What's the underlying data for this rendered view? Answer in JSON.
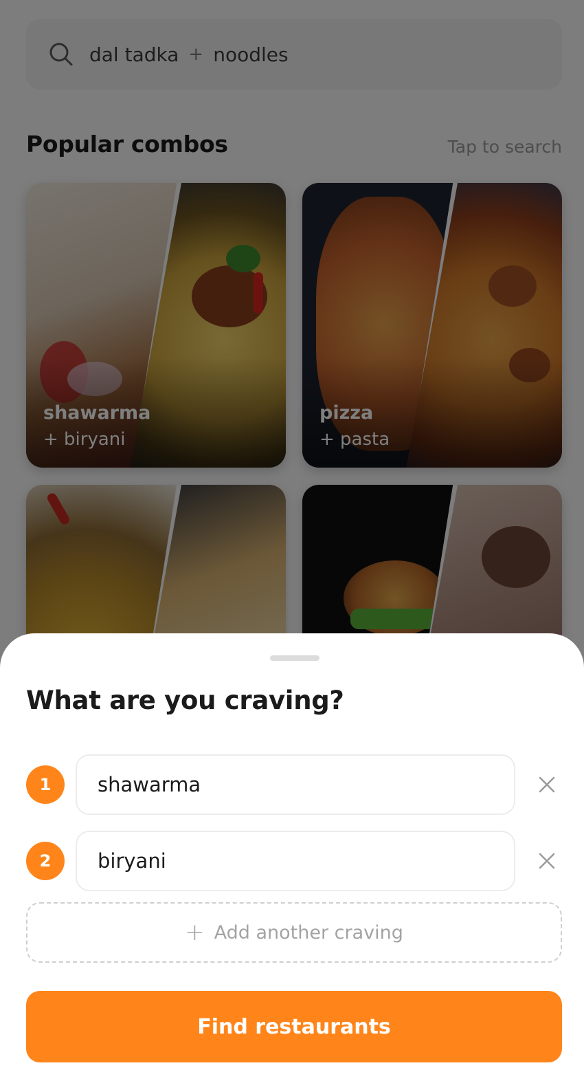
{
  "search": {
    "first": "dal tadka",
    "joiner": "+",
    "second": "noodles",
    "icon": "search-icon"
  },
  "combos_section": {
    "title": "Popular combos",
    "hint": "Tap to search"
  },
  "combos": [
    {
      "name": "shawarma",
      "sub": "+ biryani"
    },
    {
      "name": "pizza",
      "sub": "+ pasta"
    },
    {
      "name": "",
      "sub": ""
    },
    {
      "name": "",
      "sub": ""
    }
  ],
  "sheet": {
    "title": "What are you craving?",
    "cravings": [
      {
        "number": "1",
        "value": "shawarma"
      },
      {
        "number": "2",
        "value": "biryani"
      }
    ],
    "add_label": "Add another craving",
    "submit_label": "Find restaurants"
  },
  "colors": {
    "accent": "#ff851a"
  }
}
